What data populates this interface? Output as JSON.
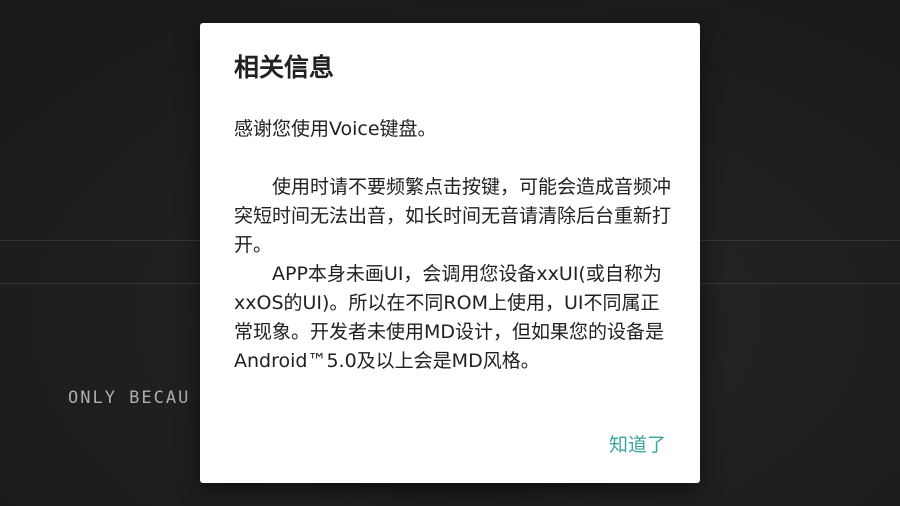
{
  "background": {
    "caption": "ONLY BECAU"
  },
  "dialog": {
    "title": "相关信息",
    "greeting": "感谢您使用Voice键盘。",
    "paragraph_1": "使用时请不要频繁点击按键，可能会造成音频冲突短时间无法出音，如长时间无音请清除后台重新打开。",
    "paragraph_2": "APP本身未画UI，会调用您设备xxUI(或自称为xxOS的UI)。所以在不同ROM上使用，UI不同属正常现象。开发者未使用MD设计，但如果您的设备是Android™5.0及以上会是MD风格。",
    "ok_label": "知道了"
  },
  "colors": {
    "accent": "#3aa59b",
    "dialog_bg": "#ffffff",
    "text": "#212121",
    "scrim": "#1e1e1e"
  }
}
